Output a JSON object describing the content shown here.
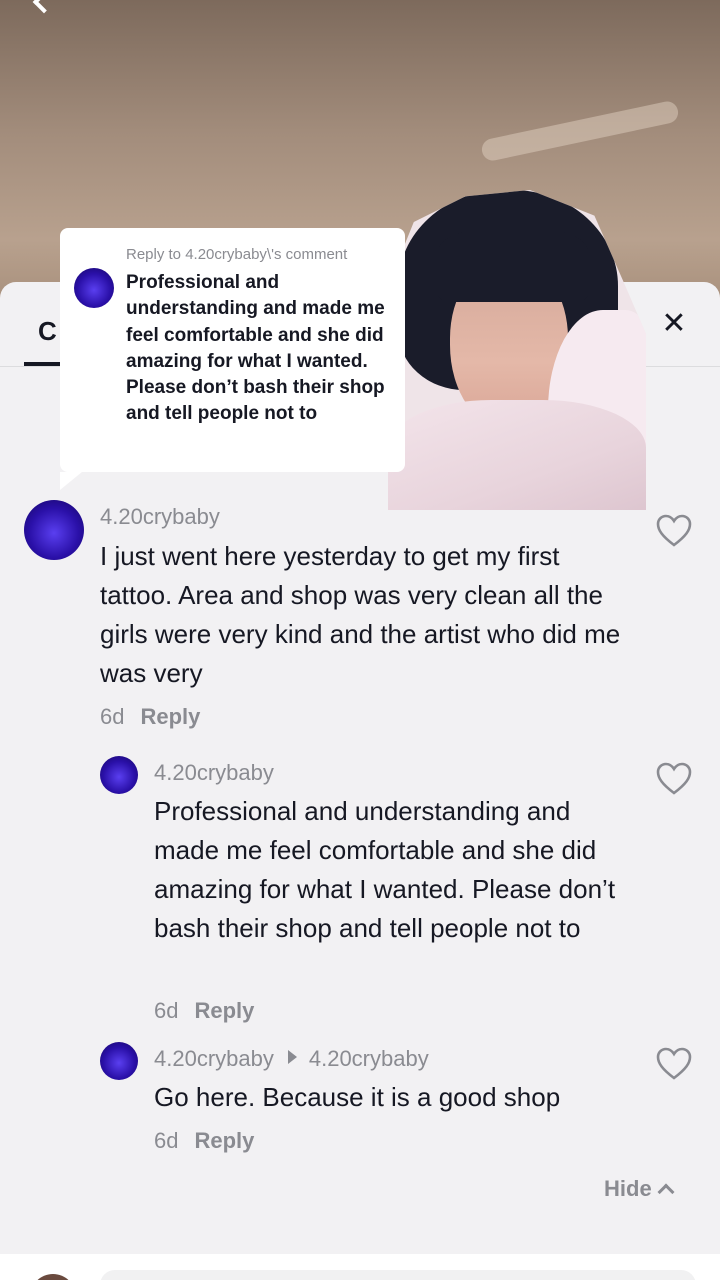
{
  "header": {
    "tab_label": "C",
    "close_label": "✕"
  },
  "reply_video": {
    "caption": "Reply to 4.20crybaby\\'s comment",
    "text": "Professional and understanding and made me feel comfortable and she did amazing for what I wanted. Please don’t bash their shop and tell people not to"
  },
  "comments": [
    {
      "username": "4.20crybaby",
      "text": "I just went here yesterday to get my first tattoo. Area and shop was very clean all the girls were very kind and the artist who did me was very",
      "time": "6d",
      "reply_label": "Reply"
    },
    {
      "username": "4.20crybaby",
      "text": "Professional and understanding and made me feel comfortable and she did amazing for what I wanted. Please don’t bash their shop and tell people not to",
      "time": "6d",
      "reply_label": "Reply"
    },
    {
      "username": "4.20crybaby",
      "reply_to": "4.20crybaby",
      "text": "Go here. Because it is a good shop",
      "time": "6d",
      "reply_label": "Reply"
    }
  ],
  "hide_label": "Hide",
  "icons": {
    "like": "heart-outline-icon",
    "close": "close-icon",
    "back": "chevron-left-icon",
    "collapse": "chevron-up-icon"
  },
  "colors": {
    "text_primary": "#161823",
    "text_secondary": "#8a8b91",
    "sheet_bg": "#f2f1f3"
  }
}
